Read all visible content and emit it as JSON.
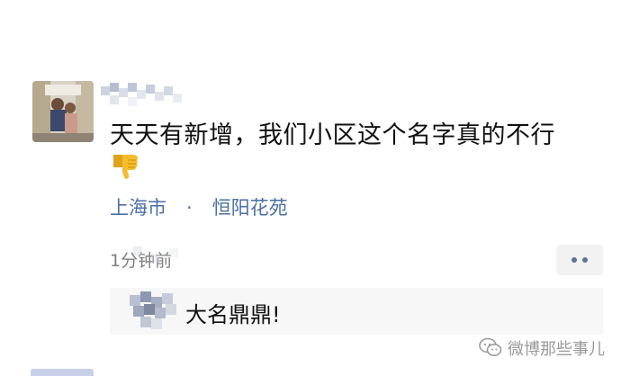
{
  "post": {
    "text": "天天有新增，我们小区这个名字真的不行",
    "reaction_emoji": "thumbs-down",
    "location": {
      "city": "上海市",
      "separator": "·",
      "place": "恒阳花苑"
    },
    "time": "1分钟前"
  },
  "comment": {
    "text": "大名鼎鼎!"
  },
  "watermark": {
    "text": "微博那些事儿"
  },
  "colors": {
    "link": "#4a6fa5",
    "text": "#111111",
    "muted": "#7f7f7f",
    "comment_bg": "#f7f7f7"
  }
}
